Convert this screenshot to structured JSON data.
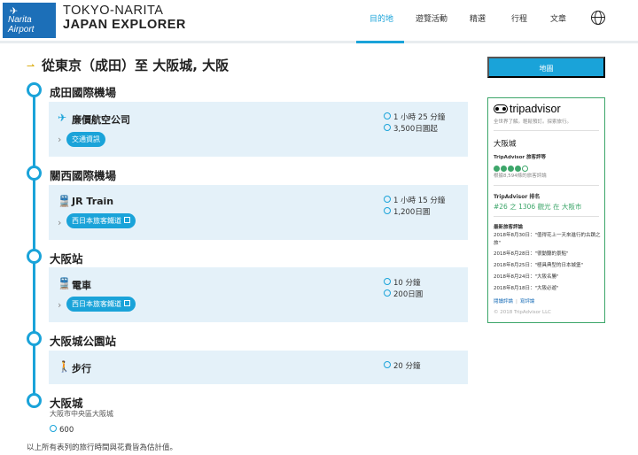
{
  "logo": {
    "line1": "Narita",
    "line2": "Airport"
  },
  "brand": {
    "line1": "TOKYO-NARITA",
    "line2": "JAPAN EXPLORER"
  },
  "nav": [
    {
      "label": "目的地",
      "active": true
    },
    {
      "label": "遊覽活動",
      "active": false
    },
    {
      "label": "精選",
      "active": false
    },
    {
      "label": "行程",
      "active": false
    },
    {
      "label": "文章",
      "active": false
    }
  ],
  "title": "從東京（成田）至 大阪城, 大阪",
  "stations": [
    "成田國際機場",
    "關西國際機場",
    "大阪站",
    "大阪城公園站",
    "大阪城"
  ],
  "segments": [
    {
      "icon": "plane-icon",
      "title": "廉價航空公司",
      "pill": "交通資訊",
      "duration": "1 小時 25 分鐘",
      "price": "3,500日圓起"
    },
    {
      "icon": "train-icon",
      "title": "JR Train",
      "pill": "西日本旅客鐵道",
      "duration": "1 小時 15 分鐘",
      "price": "1,200日圓"
    },
    {
      "icon": "train-icon",
      "title": "電車",
      "pill": "西日本旅客鐵道",
      "duration": "10 分鐘",
      "price": "200日圓"
    },
    {
      "icon": "walk-icon",
      "title": "步行",
      "pill": "",
      "duration": "20 分鐘",
      "price": ""
    }
  ],
  "destination": {
    "address": "大阪市中央區大阪城",
    "price": "600"
  },
  "footnote": "以上所有表列的旅行時間與花費皆為估計值。",
  "map_button": "地圖",
  "tripadvisor": {
    "logo": "tripadvisor",
    "tagline": "全世界了解。輕鬆預訂。探索旅行。",
    "location": "大阪城",
    "rating_label": "TripAdvisor 旅客評等",
    "bubbles": 4,
    "reviews": "根據8,594條的旅客評論",
    "rank_label": "TripAdvisor 排名",
    "rank": "#26 之 1306 觀光 在 大阪市",
    "recent_label": "最新旅客評論",
    "recent": [
      "2018年8月30日：\"值得花上一天來進行的古蹟之旅\"",
      "2018年8月28日：\"很動聽的景點\"",
      "2018年8月25日：\"極具典型的日本城堡\"",
      "2018年8月24日：\"大阪名勝\"",
      "2018年8月18日：\"大阪必遊\""
    ],
    "link_reviews": "閱讀評論",
    "link_write": "寫評論",
    "copyright": "© 2018 TripAdvisor LLC"
  },
  "colors": {
    "accent": "#1aa3d9",
    "segment_bg": "#e4f1f9",
    "tripadvisor_green": "#3da66a",
    "logo_blue": "#1c6fb8"
  }
}
